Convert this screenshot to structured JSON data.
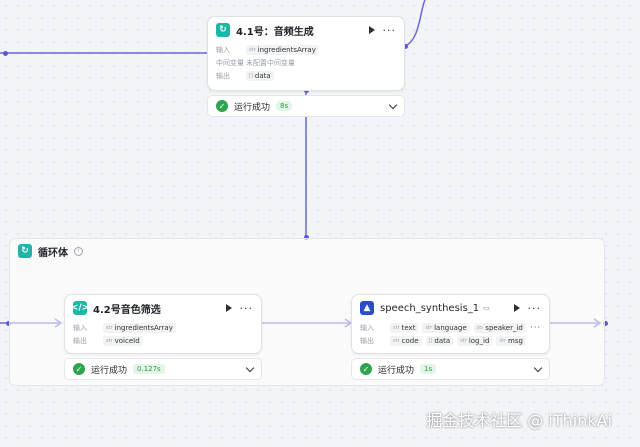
{
  "labels": {
    "input": "输入",
    "output": "输出",
    "intermediate": "中间变量"
  },
  "type_tags": {
    "array": "[]",
    "string": "str"
  },
  "node_top": {
    "title": "4.1号：音频生成",
    "input_var": "ingredientsArray",
    "intermediate_text": "未配置中间变量",
    "output_var": "data",
    "status": "运行成功",
    "time": "8s"
  },
  "loop": {
    "title": "循环体"
  },
  "node_left": {
    "title": "4.2号音色筛选",
    "input_var": "ingredientsArray",
    "output_var": "voiceId",
    "status": "运行成功",
    "time": "0.127s"
  },
  "node_right": {
    "title": "speech_synthesis_1",
    "inputs": [
      "text",
      "language",
      "speaker_id"
    ],
    "outputs": [
      "code",
      "data",
      "log_id",
      "msg"
    ],
    "status": "运行成功",
    "time": "1s"
  },
  "watermark": "掘金技术社区 @ iThinkAi",
  "colors": {
    "edge": "#6a66d9",
    "success": "#2ea44f",
    "loop_icon": "#1fb5a8",
    "tts_icon": "#2b4cc9"
  }
}
